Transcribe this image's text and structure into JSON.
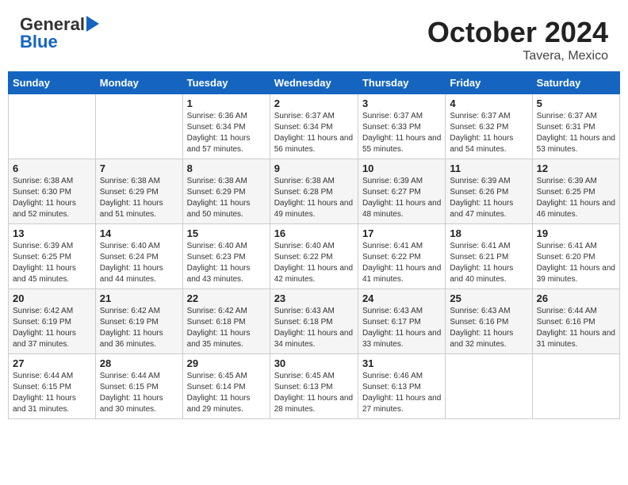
{
  "header": {
    "logo_line1": "General",
    "logo_line2": "Blue",
    "month_year": "October 2024",
    "location": "Tavera, Mexico"
  },
  "days_of_week": [
    "Sunday",
    "Monday",
    "Tuesday",
    "Wednesday",
    "Thursday",
    "Friday",
    "Saturday"
  ],
  "weeks": [
    [
      {
        "day": "",
        "info": ""
      },
      {
        "day": "",
        "info": ""
      },
      {
        "day": "1",
        "info": "Sunrise: 6:36 AM\nSunset: 6:34 PM\nDaylight: 11 hours and 57 minutes."
      },
      {
        "day": "2",
        "info": "Sunrise: 6:37 AM\nSunset: 6:34 PM\nDaylight: 11 hours and 56 minutes."
      },
      {
        "day": "3",
        "info": "Sunrise: 6:37 AM\nSunset: 6:33 PM\nDaylight: 11 hours and 55 minutes."
      },
      {
        "day": "4",
        "info": "Sunrise: 6:37 AM\nSunset: 6:32 PM\nDaylight: 11 hours and 54 minutes."
      },
      {
        "day": "5",
        "info": "Sunrise: 6:37 AM\nSunset: 6:31 PM\nDaylight: 11 hours and 53 minutes."
      }
    ],
    [
      {
        "day": "6",
        "info": "Sunrise: 6:38 AM\nSunset: 6:30 PM\nDaylight: 11 hours and 52 minutes."
      },
      {
        "day": "7",
        "info": "Sunrise: 6:38 AM\nSunset: 6:29 PM\nDaylight: 11 hours and 51 minutes."
      },
      {
        "day": "8",
        "info": "Sunrise: 6:38 AM\nSunset: 6:29 PM\nDaylight: 11 hours and 50 minutes."
      },
      {
        "day": "9",
        "info": "Sunrise: 6:38 AM\nSunset: 6:28 PM\nDaylight: 11 hours and 49 minutes."
      },
      {
        "day": "10",
        "info": "Sunrise: 6:39 AM\nSunset: 6:27 PM\nDaylight: 11 hours and 48 minutes."
      },
      {
        "day": "11",
        "info": "Sunrise: 6:39 AM\nSunset: 6:26 PM\nDaylight: 11 hours and 47 minutes."
      },
      {
        "day": "12",
        "info": "Sunrise: 6:39 AM\nSunset: 6:25 PM\nDaylight: 11 hours and 46 minutes."
      }
    ],
    [
      {
        "day": "13",
        "info": "Sunrise: 6:39 AM\nSunset: 6:25 PM\nDaylight: 11 hours and 45 minutes."
      },
      {
        "day": "14",
        "info": "Sunrise: 6:40 AM\nSunset: 6:24 PM\nDaylight: 11 hours and 44 minutes."
      },
      {
        "day": "15",
        "info": "Sunrise: 6:40 AM\nSunset: 6:23 PM\nDaylight: 11 hours and 43 minutes."
      },
      {
        "day": "16",
        "info": "Sunrise: 6:40 AM\nSunset: 6:22 PM\nDaylight: 11 hours and 42 minutes."
      },
      {
        "day": "17",
        "info": "Sunrise: 6:41 AM\nSunset: 6:22 PM\nDaylight: 11 hours and 41 minutes."
      },
      {
        "day": "18",
        "info": "Sunrise: 6:41 AM\nSunset: 6:21 PM\nDaylight: 11 hours and 40 minutes."
      },
      {
        "day": "19",
        "info": "Sunrise: 6:41 AM\nSunset: 6:20 PM\nDaylight: 11 hours and 39 minutes."
      }
    ],
    [
      {
        "day": "20",
        "info": "Sunrise: 6:42 AM\nSunset: 6:19 PM\nDaylight: 11 hours and 37 minutes."
      },
      {
        "day": "21",
        "info": "Sunrise: 6:42 AM\nSunset: 6:19 PM\nDaylight: 11 hours and 36 minutes."
      },
      {
        "day": "22",
        "info": "Sunrise: 6:42 AM\nSunset: 6:18 PM\nDaylight: 11 hours and 35 minutes."
      },
      {
        "day": "23",
        "info": "Sunrise: 6:43 AM\nSunset: 6:18 PM\nDaylight: 11 hours and 34 minutes."
      },
      {
        "day": "24",
        "info": "Sunrise: 6:43 AM\nSunset: 6:17 PM\nDaylight: 11 hours and 33 minutes."
      },
      {
        "day": "25",
        "info": "Sunrise: 6:43 AM\nSunset: 6:16 PM\nDaylight: 11 hours and 32 minutes."
      },
      {
        "day": "26",
        "info": "Sunrise: 6:44 AM\nSunset: 6:16 PM\nDaylight: 11 hours and 31 minutes."
      }
    ],
    [
      {
        "day": "27",
        "info": "Sunrise: 6:44 AM\nSunset: 6:15 PM\nDaylight: 11 hours and 31 minutes."
      },
      {
        "day": "28",
        "info": "Sunrise: 6:44 AM\nSunset: 6:15 PM\nDaylight: 11 hours and 30 minutes."
      },
      {
        "day": "29",
        "info": "Sunrise: 6:45 AM\nSunset: 6:14 PM\nDaylight: 11 hours and 29 minutes."
      },
      {
        "day": "30",
        "info": "Sunrise: 6:45 AM\nSunset: 6:13 PM\nDaylight: 11 hours and 28 minutes."
      },
      {
        "day": "31",
        "info": "Sunrise: 6:46 AM\nSunset: 6:13 PM\nDaylight: 11 hours and 27 minutes."
      },
      {
        "day": "",
        "info": ""
      },
      {
        "day": "",
        "info": ""
      }
    ]
  ]
}
